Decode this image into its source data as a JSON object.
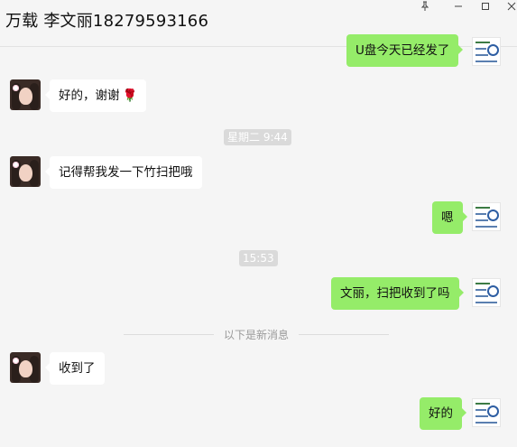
{
  "window": {
    "title": "万载 李文丽18279593166",
    "controls": {
      "pin": "pin-icon",
      "minimize": "minimize-icon",
      "maximize": "maximize-icon",
      "close": "close-icon"
    }
  },
  "messages": [
    {
      "dir": "out",
      "text": "U盘今天已经发了"
    },
    {
      "dir": "in",
      "text": "好的，谢谢",
      "emoji": "🌹"
    },
    {
      "type": "time",
      "text": "星期二 9:44"
    },
    {
      "dir": "in",
      "text": "记得帮我发一下竹扫把哦"
    },
    {
      "dir": "out",
      "text": "嗯"
    },
    {
      "type": "time",
      "text": "15:53"
    },
    {
      "dir": "out",
      "text": "文丽，扫把收到了吗"
    },
    {
      "type": "divider",
      "text": "以下是新消息"
    },
    {
      "dir": "in",
      "text": "收到了"
    },
    {
      "dir": "out",
      "text": "好的"
    }
  ],
  "colors": {
    "outgoing_bubble": "#95ec69",
    "incoming_bubble": "#ffffff",
    "background": "#f5f5f5"
  }
}
